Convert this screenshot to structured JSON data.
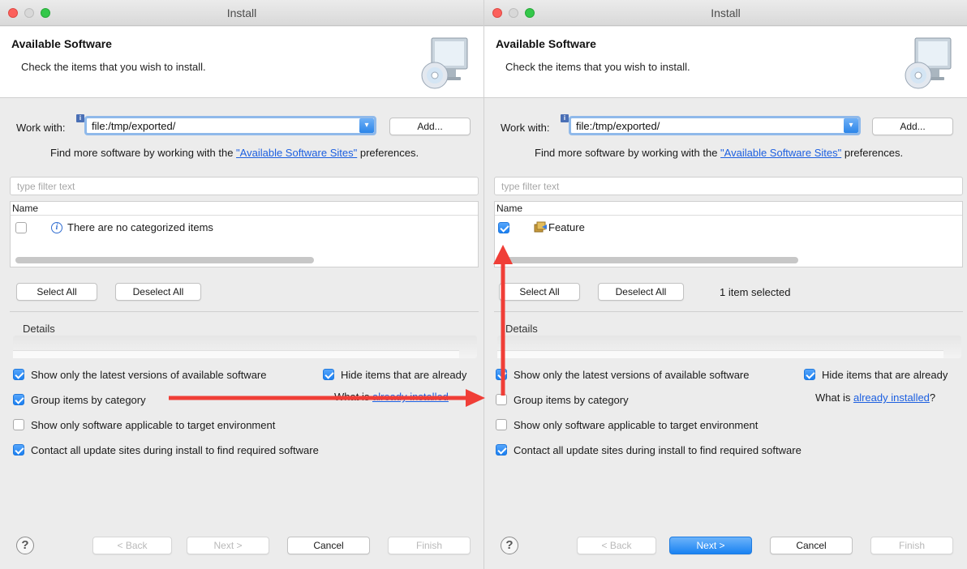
{
  "left": {
    "title": "Install",
    "banner_title": "Available Software",
    "banner_desc": "Check the items that you wish to install.",
    "work_with_label": "Work with:",
    "work_with_value": "file:/tmp/exported/",
    "add_label": "Add...",
    "find_more_prefix": "Find more software by working with the ",
    "find_more_link": "\"Available Software Sites\"",
    "find_more_suffix": " preferences.",
    "filter_placeholder": "type filter text",
    "tree_header": "Name",
    "tree_item": "There are no categorized items",
    "tree_item_checked": false,
    "select_all": "Select All",
    "deselect_all": "Deselect All",
    "selection_status": "",
    "details_label": "Details",
    "opt_latest": "Show only the latest versions of available software",
    "opt_hide": "Hide items that are already",
    "opt_group": "Group items by category",
    "what_is_prefix": "What is ",
    "what_is_link": "already installed",
    "what_is_suffix": "",
    "opt_target": "Show only software applicable to target environment",
    "opt_contact": "Contact all update sites during install to find required software",
    "checks": {
      "latest": true,
      "hide": true,
      "group": true,
      "target": false,
      "contact": true
    },
    "back": "< Back",
    "next": "Next >",
    "cancel": "Cancel",
    "finish": "Finish",
    "help": "?"
  },
  "right": {
    "title": "Install",
    "banner_title": "Available Software",
    "banner_desc": "Check the items that you wish to install.",
    "work_with_label": "Work with:",
    "work_with_value": "file:/tmp/exported/",
    "add_label": "Add...",
    "find_more_prefix": "Find more software by working with the ",
    "find_more_link": "\"Available Software Sites\"",
    "find_more_suffix": " preferences.",
    "filter_placeholder": "type filter text",
    "tree_header": "Name",
    "tree_item": "Feature",
    "tree_item_checked": true,
    "select_all": "Select All",
    "deselect_all": "Deselect All",
    "selection_status": "1 item selected",
    "details_label": "Details",
    "opt_latest": "Show only the latest versions of available software",
    "opt_hide": "Hide items that are already",
    "opt_group": "Group items by category",
    "what_is_prefix": "What is ",
    "what_is_link": "already installed",
    "what_is_suffix": "?",
    "opt_target": "Show only software applicable to target environment",
    "opt_contact": "Contact all update sites during install to find required software",
    "checks": {
      "latest": true,
      "hide": true,
      "group": false,
      "target": false,
      "contact": true
    },
    "back": "< Back",
    "next": "Next >",
    "cancel": "Cancel",
    "finish": "Finish",
    "help": "?"
  },
  "colors": {
    "annotation_arrow": "#f03e37",
    "accent": "#1a82f2",
    "link": "#1c5fe0"
  },
  "icons": [
    "monitor-cd-icon",
    "info-icon",
    "feature-icon",
    "help-icon",
    "chevron-down-icon",
    "checkbox-icon"
  ]
}
